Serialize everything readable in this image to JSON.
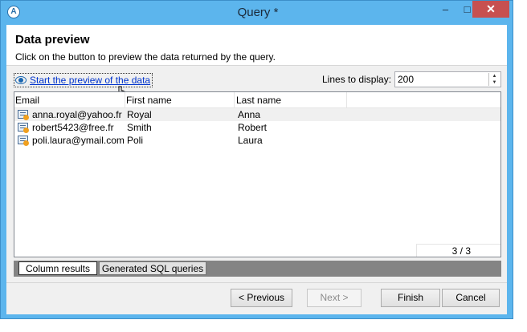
{
  "window": {
    "title": "Query *",
    "minimize": "–",
    "maximize": "□",
    "close": "✕",
    "accent": "#5cb5ed"
  },
  "header": {
    "title": "Data preview",
    "subtitle": "Click on the button to preview the data returned by the query."
  },
  "toolbar": {
    "preview_link": "Start the preview of the data",
    "lines_label": "Lines to display:",
    "lines_value": "200"
  },
  "grid": {
    "columns": [
      "Email",
      "First name",
      "Last name"
    ],
    "rows": [
      {
        "email": "anna.royal@yahoo.fr",
        "first_name": "Royal",
        "last_name": "Anna"
      },
      {
        "email": "robert5423@free.fr",
        "first_name": "Smith",
        "last_name": "Robert"
      },
      {
        "email": "poli.laura@ymail.com",
        "first_name": "Poli",
        "last_name": "Laura"
      }
    ],
    "count": "3 / 3"
  },
  "tabs": [
    {
      "label": "Column results"
    },
    {
      "label": "Generated SQL queries"
    }
  ],
  "buttons": {
    "previous": "< Previous",
    "next": "Next >",
    "finish": "Finish",
    "cancel": "Cancel"
  }
}
